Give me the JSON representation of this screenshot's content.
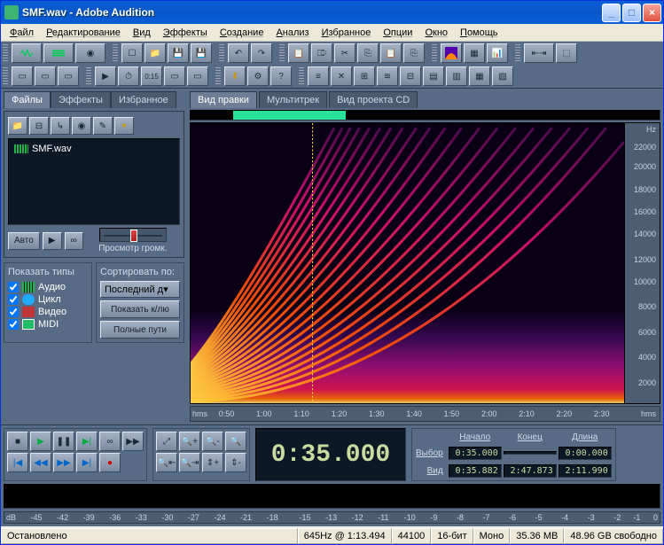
{
  "window": {
    "title": "SMF.wav - Adobe Audition"
  },
  "menu": [
    "Файл",
    "Редактирование",
    "Вид",
    "Эффекты",
    "Создание",
    "Анализ",
    "Избранное",
    "Опции",
    "Окно",
    "Помощь"
  ],
  "sidebar": {
    "tabs": [
      "Файлы",
      "Эффекты",
      "Избранное"
    ],
    "active_tab": 0,
    "file": "SMF.wav",
    "auto_btn": "Авто",
    "volume_label": "Просмотр громк.",
    "show_types": {
      "title": "Показать типы",
      "items": [
        "Аудио",
        "Цикл",
        "Видео",
        "MIDI"
      ]
    },
    "sort": {
      "title": "Сортировать по:",
      "value": "Последний д"
    },
    "show_hint_btn": "Показать к/лю",
    "full_paths_btn": "Полные пути"
  },
  "view_tabs": [
    "Вид правки",
    "Мультитрек",
    "Вид проекта CD"
  ],
  "active_view_tab": 0,
  "freq_axis": {
    "unit": "Hz",
    "ticks": [
      22000,
      20000,
      18000,
      16000,
      14000,
      12000,
      10000,
      8000,
      6000,
      4000,
      2000
    ]
  },
  "time_axis": {
    "unit": "hms",
    "ticks": [
      "0:50",
      "1:00",
      "1:10",
      "1:20",
      "1:30",
      "1:40",
      "1:50",
      "2:00",
      "2:10",
      "2:20",
      "2:30"
    ]
  },
  "time_display": "0:35.000",
  "selection": {
    "headers": [
      "Начало",
      "Конец",
      "Длина"
    ],
    "row1_label": "Выбор",
    "row2_label": "Вид",
    "row1": [
      "0:35.000",
      "",
      "0:00.000"
    ],
    "row2": [
      "0:35.882",
      "2:47.873",
      "2:11.990"
    ]
  },
  "db_ruler": {
    "unit": "dB",
    "ticks": [
      -45,
      -42,
      -39,
      -36,
      -33,
      -30,
      -27,
      -24,
      -21,
      -18,
      -15,
      -13,
      -12,
      -11,
      -10,
      -9,
      -8,
      -7,
      -6,
      -5,
      -4,
      -3,
      -2,
      -1,
      0
    ]
  },
  "status": {
    "state": "Остановлено",
    "cursor": "645Hz @ 1:13.494",
    "sample_rate": "44100",
    "bit_depth": "16-бит",
    "channels": "Моно",
    "file_size": "35.36 MB",
    "disk_free": "48.96 GB свободно"
  },
  "chart_data": {
    "type": "heatmap",
    "description": "Spectrogram of SMF.wav showing frequency (Hz, linear 0-22000) vs time (hms 0:35.882 to 2:47.873). Harmonic sweep pattern with fundamental rising from low frequency to ~20kHz; many harmonics visible as curved ascending lines, intensity strongest at low frequencies fading to dark purple at high frequencies.",
    "x_range_time": [
      "0:35.882",
      "2:47.873"
    ],
    "y_range_hz": [
      0,
      22000
    ],
    "colormap": "magma-like (dark purple -> magenta -> orange -> yellow)",
    "cursor_position": {
      "time": "1:13.494",
      "freq_hz": 645
    }
  }
}
